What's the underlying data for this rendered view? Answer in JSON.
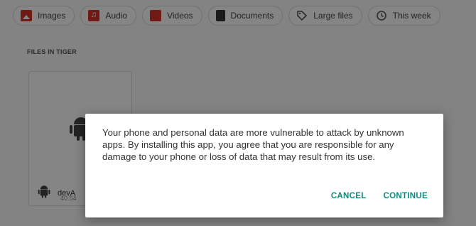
{
  "filters": [
    {
      "label": "Images",
      "icon": "image-icon"
    },
    {
      "label": "Audio",
      "icon": "audio-icon"
    },
    {
      "label": "Videos",
      "icon": "video-icon"
    },
    {
      "label": "Documents",
      "icon": "document-icon"
    },
    {
      "label": "Large files",
      "icon": "tag-icon"
    },
    {
      "label": "This week",
      "icon": "history-icon"
    }
  ],
  "section_title": "FILES IN TIGER",
  "file": {
    "name": "devA",
    "size": "40.54",
    "icon": "android-icon"
  },
  "dialog": {
    "message": "Your phone and personal data are more vulnerable to attack by unknown apps. By installing this app, you agree that you are responsible for any damage to your phone or loss of data that may result from its use.",
    "cancel_label": "CANCEL",
    "continue_label": "CONTINUE"
  },
  "colors": {
    "accent": "#0b8a7e",
    "category_icon": "#d93025",
    "scrim": "rgba(0,0,0,0.48)"
  }
}
